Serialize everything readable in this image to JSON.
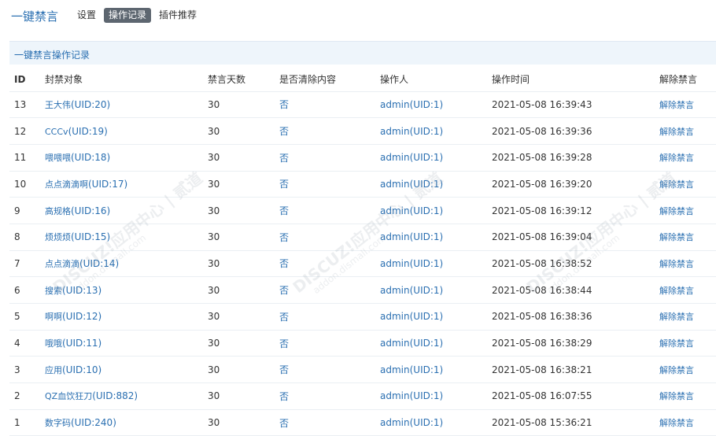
{
  "header": {
    "title": "一键禁言",
    "tabs": [
      {
        "label": "设置",
        "active": false
      },
      {
        "label": "操作记录",
        "active": true
      },
      {
        "label": "插件推荐",
        "active": false
      }
    ]
  },
  "panel": {
    "title": "一键禁言操作记录"
  },
  "table": {
    "columns": {
      "id": "ID",
      "target": "封禁对象",
      "days": "禁言天数",
      "clear": "是否清除内容",
      "operator": "操作人",
      "time": "操作时间",
      "action": "解除禁言"
    },
    "rows": [
      {
        "id": "13",
        "target": "王大伟",
        "uid": "(UID:20)",
        "days": "30",
        "clear": "否",
        "operator": "admin(UID:1)",
        "time": "2021-05-08 16:39:43",
        "action": "解除禁言"
      },
      {
        "id": "12",
        "target": "CCCv",
        "uid": "(UID:19)",
        "days": "30",
        "clear": "否",
        "operator": "admin(UID:1)",
        "time": "2021-05-08 16:39:36",
        "action": "解除禁言"
      },
      {
        "id": "11",
        "target": "喂喂喂",
        "uid": "(UID:18)",
        "days": "30",
        "clear": "否",
        "operator": "admin(UID:1)",
        "time": "2021-05-08 16:39:28",
        "action": "解除禁言"
      },
      {
        "id": "10",
        "target": "点点滴滴啊",
        "uid": "(UID:17)",
        "days": "30",
        "clear": "否",
        "operator": "admin(UID:1)",
        "time": "2021-05-08 16:39:20",
        "action": "解除禁言"
      },
      {
        "id": "9",
        "target": "高规格",
        "uid": "(UID:16)",
        "days": "30",
        "clear": "否",
        "operator": "admin(UID:1)",
        "time": "2021-05-08 16:39:12",
        "action": "解除禁言"
      },
      {
        "id": "8",
        "target": "烦烦烦",
        "uid": "(UID:15)",
        "days": "30",
        "clear": "否",
        "operator": "admin(UID:1)",
        "time": "2021-05-08 16:39:04",
        "action": "解除禁言"
      },
      {
        "id": "7",
        "target": "点点滴滴",
        "uid": "(UID:14)",
        "days": "30",
        "clear": "否",
        "operator": "admin(UID:1)",
        "time": "2021-05-08 16:38:52",
        "action": "解除禁言"
      },
      {
        "id": "6",
        "target": "搜索",
        "uid": "(UID:13)",
        "days": "30",
        "clear": "否",
        "operator": "admin(UID:1)",
        "time": "2021-05-08 16:38:44",
        "action": "解除禁言"
      },
      {
        "id": "5",
        "target": "啊啊",
        "uid": "(UID:12)",
        "days": "30",
        "clear": "否",
        "operator": "admin(UID:1)",
        "time": "2021-05-08 16:38:36",
        "action": "解除禁言"
      },
      {
        "id": "4",
        "target": "哦哦",
        "uid": "(UID:11)",
        "days": "30",
        "clear": "否",
        "operator": "admin(UID:1)",
        "time": "2021-05-08 16:38:29",
        "action": "解除禁言"
      },
      {
        "id": "3",
        "target": "应用",
        "uid": "(UID:10)",
        "days": "30",
        "clear": "否",
        "operator": "admin(UID:1)",
        "time": "2021-05-08 16:38:21",
        "action": "解除禁言"
      },
      {
        "id": "2",
        "target": "QZ血饮狂刀",
        "uid": "(UID:882)",
        "days": "30",
        "clear": "否",
        "operator": "admin(UID:1)",
        "time": "2021-05-08 16:07:55",
        "action": "解除禁言"
      },
      {
        "id": "1",
        "target": "数字码",
        "uid": "(UID:240)",
        "days": "30",
        "clear": "否",
        "operator": "admin(UID:1)",
        "time": "2021-05-08 15:36:21",
        "action": "解除禁言"
      }
    ]
  },
  "watermark": {
    "brand": "DISCUZ!应用中心 | 贰道",
    "url": "addon.dismall.com"
  }
}
